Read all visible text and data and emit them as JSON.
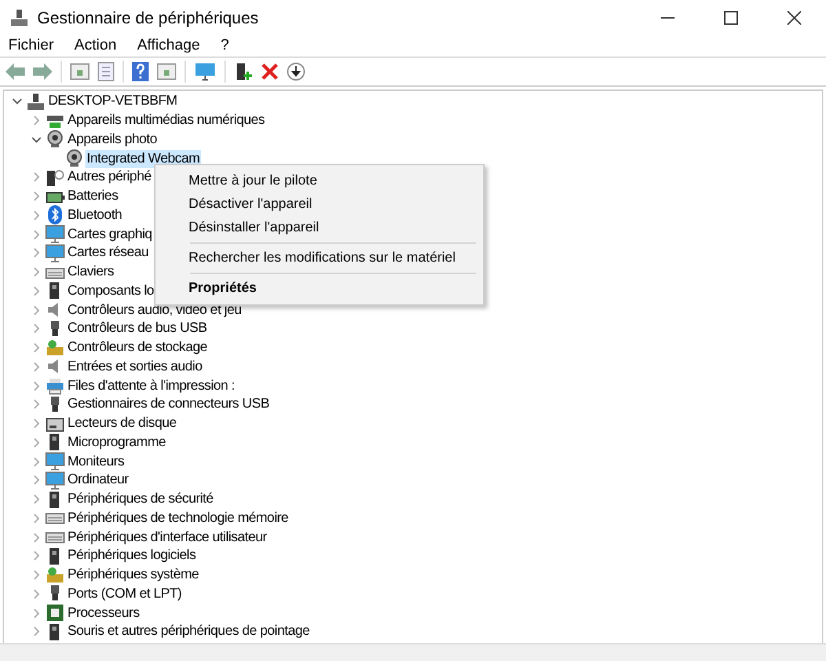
{
  "window": {
    "title": "Gestionnaire de périphériques"
  },
  "menu": [
    "Fichier",
    "Action",
    "Affichage",
    "?"
  ],
  "tree": {
    "label": "DESKTOP-VETBBFM",
    "kind": "computer",
    "expanded": true,
    "selected": false,
    "children": [
      {
        "label": "Appareils multimédias numériques",
        "kind": "media",
        "expanded": false,
        "selected": false
      },
      {
        "label": "Appareils photo",
        "kind": "camera",
        "expanded": true,
        "selected": false,
        "children": [
          {
            "label": "Integrated Webcam",
            "kind": "camera",
            "selected": true
          }
        ]
      },
      {
        "label": "Autres périphé",
        "kind": "unknown",
        "expanded": false,
        "selected": false
      },
      {
        "label": "Batteries",
        "kind": "battery",
        "expanded": false,
        "selected": false
      },
      {
        "label": "Bluetooth",
        "kind": "bluetooth",
        "expanded": false,
        "selected": false
      },
      {
        "label": "Cartes graphiq",
        "kind": "monitor",
        "expanded": false,
        "selected": false
      },
      {
        "label": "Cartes réseau",
        "kind": "monitor",
        "expanded": false,
        "selected": false
      },
      {
        "label": "Claviers",
        "kind": "keyboard",
        "expanded": false,
        "selected": false
      },
      {
        "label": "Composants lo",
        "kind": "device",
        "expanded": false,
        "selected": false
      },
      {
        "label": "Contrôleurs audio, vidéo et jeu",
        "kind": "speaker",
        "expanded": false,
        "selected": false
      },
      {
        "label": "Contrôleurs de bus USB",
        "kind": "usb",
        "expanded": false,
        "selected": false
      },
      {
        "label": "Contrôleurs de stockage",
        "kind": "storage",
        "expanded": false,
        "selected": false
      },
      {
        "label": "Entrées et sorties audio",
        "kind": "speaker",
        "expanded": false,
        "selected": false
      },
      {
        "label": "Files d'attente à l'impression :",
        "kind": "printer",
        "expanded": false,
        "selected": false
      },
      {
        "label": "Gestionnaires de connecteurs USB",
        "kind": "usb",
        "expanded": false,
        "selected": false
      },
      {
        "label": "Lecteurs de disque",
        "kind": "disk",
        "expanded": false,
        "selected": false
      },
      {
        "label": "Microprogramme",
        "kind": "device",
        "expanded": false,
        "selected": false
      },
      {
        "label": "Moniteurs",
        "kind": "monitor",
        "expanded": false,
        "selected": false
      },
      {
        "label": "Ordinateur",
        "kind": "monitor",
        "expanded": false,
        "selected": false
      },
      {
        "label": "Périphériques de sécurité",
        "kind": "device",
        "expanded": false,
        "selected": false
      },
      {
        "label": "Périphériques de technologie mémoire",
        "kind": "keyboard",
        "expanded": false,
        "selected": false
      },
      {
        "label": "Périphériques d'interface utilisateur",
        "kind": "keyboard",
        "expanded": false,
        "selected": false
      },
      {
        "label": "Périphériques logiciels",
        "kind": "device",
        "expanded": false,
        "selected": false
      },
      {
        "label": "Périphériques système",
        "kind": "storage",
        "expanded": false,
        "selected": false
      },
      {
        "label": "Ports (COM et LPT)",
        "kind": "usb",
        "expanded": false,
        "selected": false
      },
      {
        "label": "Processeurs",
        "kind": "chip",
        "expanded": false,
        "selected": false
      },
      {
        "label": "Souris et autres périphériques de pointage",
        "kind": "device",
        "expanded": false,
        "selected": false
      }
    ]
  },
  "context_menu": [
    {
      "label": "Mettre à jour le pilote",
      "separator_before": false,
      "default": false
    },
    {
      "label": "Désactiver l'appareil",
      "separator_before": false,
      "default": false
    },
    {
      "label": "Désinstaller l'appareil",
      "separator_before": false,
      "default": false
    },
    {
      "label": "Rechercher les modifications sur le matériel",
      "separator_before": true,
      "default": false
    },
    {
      "label": "Propriétés",
      "separator_before": true,
      "default": true
    }
  ]
}
